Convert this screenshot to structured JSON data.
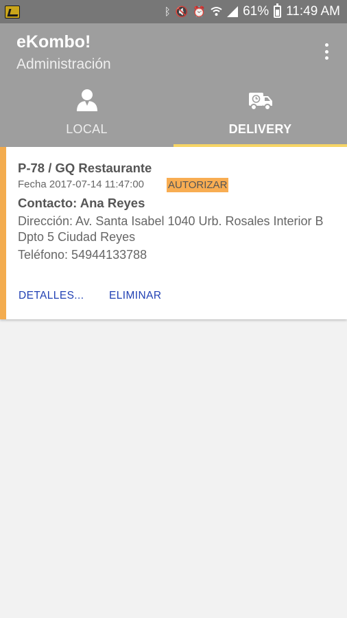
{
  "status_bar": {
    "battery": "61%",
    "time": "11:49 AM",
    "icons": [
      "app-notification-icon",
      "bluetooth-icon",
      "mute-icon",
      "alarm-icon",
      "wifi-icon",
      "signal-icon",
      "battery-icon"
    ]
  },
  "app_bar": {
    "title": "eKombo!",
    "subtitle": "Administración"
  },
  "tabs": [
    {
      "label": "LOCAL",
      "icon": "person-icon",
      "active": false
    },
    {
      "label": "DELIVERY",
      "icon": "delivery-truck-icon",
      "active": true
    }
  ],
  "order": {
    "code": "P-78 / GQ Restaurante",
    "date": "Fecha 2017-07-14 11:47:00",
    "status": "AUTORIZAR",
    "contact": "Contacto: Ana Reyes",
    "address": "Dirección: Av. Santa Isabel 1040 Urb. Rosales Interior B Dpto 5 Ciudad Reyes",
    "phone": "Teléfono:  54944133788",
    "actions": {
      "details": "DETALLES...",
      "delete": "ELIMINAR"
    }
  },
  "colors": {
    "status_bar": "#777777",
    "app_bar": "#9e9e9e",
    "tab_indicator": "#f7d565",
    "card_accent": "#f3ac4f",
    "status_badge": "#f8ad52",
    "action_text": "#1f3fb3"
  }
}
